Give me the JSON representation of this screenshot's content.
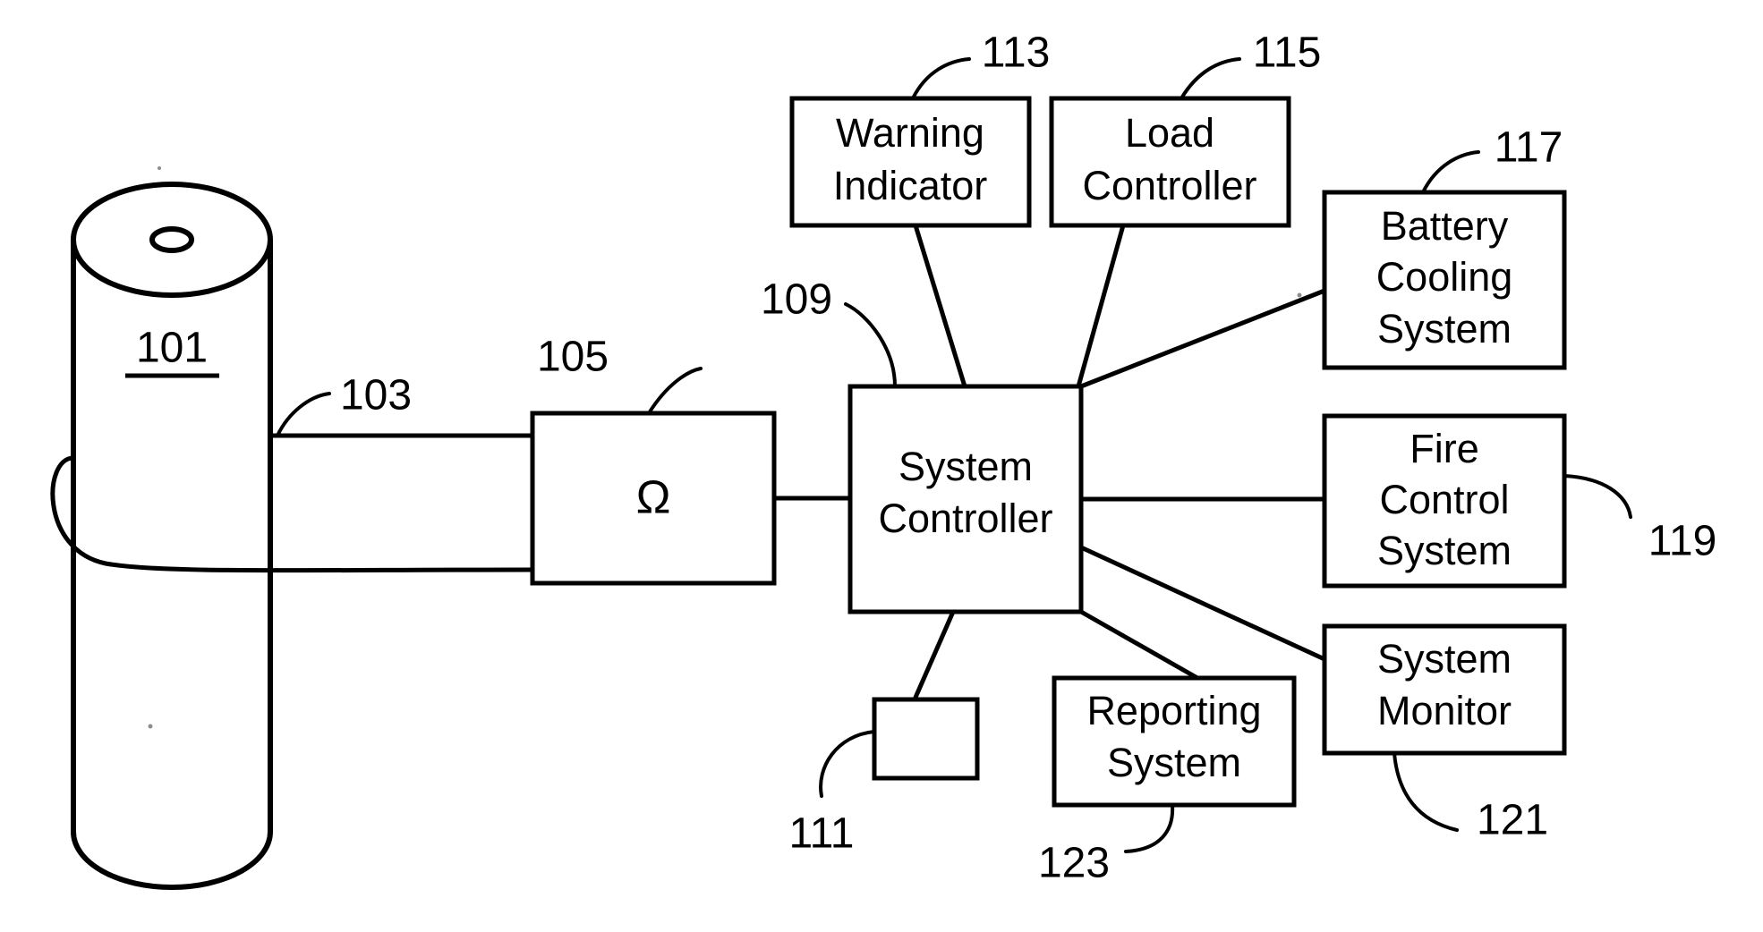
{
  "figure": {
    "title": "Battery monitoring and control system block diagram",
    "background_color": "#ffffff",
    "line_color": "#000000"
  },
  "battery": {
    "name": "battery-cylinder",
    "ref": "101"
  },
  "connections_label": {
    "sensor_leads_ref": "103"
  },
  "blocks": [
    {
      "id": "impedance",
      "label": "Ω",
      "ref": "105"
    },
    {
      "id": "system_controller",
      "label_line1": "System",
      "label_line2": "Controller",
      "ref": "109"
    },
    {
      "id": "small_unit",
      "label": "",
      "ref": "111"
    },
    {
      "id": "warning_indicator",
      "label_line1": "Warning",
      "label_line2": "Indicator",
      "ref": "113"
    },
    {
      "id": "load_controller",
      "label_line1": "Load",
      "label_line2": "Controller",
      "ref": "115"
    },
    {
      "id": "battery_cooling",
      "label_line1": "Battery",
      "label_line2": "Cooling",
      "label_line3": "System",
      "ref": "117"
    },
    {
      "id": "fire_control",
      "label_line1": "Fire",
      "label_line2": "Control",
      "label_line3": "System",
      "ref": "119"
    },
    {
      "id": "system_monitor",
      "label_line1": "System",
      "label_line2": "Monitor",
      "ref": "121"
    },
    {
      "id": "reporting_system",
      "label_line1": "Reporting",
      "label_line2": "System",
      "ref": "123"
    }
  ],
  "refs": {
    "r101": "101",
    "r103": "103",
    "r105": "105",
    "r109": "109",
    "r111": "111",
    "r113": "113",
    "r115": "115",
    "r117": "117",
    "r119": "119",
    "r121": "121",
    "r123": "123"
  },
  "labels": {
    "omega": "Ω",
    "system_1": "System",
    "system_2": "Controller",
    "warning_1": "Warning",
    "warning_2": "Indicator",
    "load_1": "Load",
    "load_2": "Controller",
    "cooling_1": "Battery",
    "cooling_2": "Cooling",
    "cooling_3": "System",
    "fire_1": "Fire",
    "fire_2": "Control",
    "fire_3": "System",
    "monitor_1": "System",
    "monitor_2": "Monitor",
    "reporting_1": "Reporting",
    "reporting_2": "System"
  }
}
